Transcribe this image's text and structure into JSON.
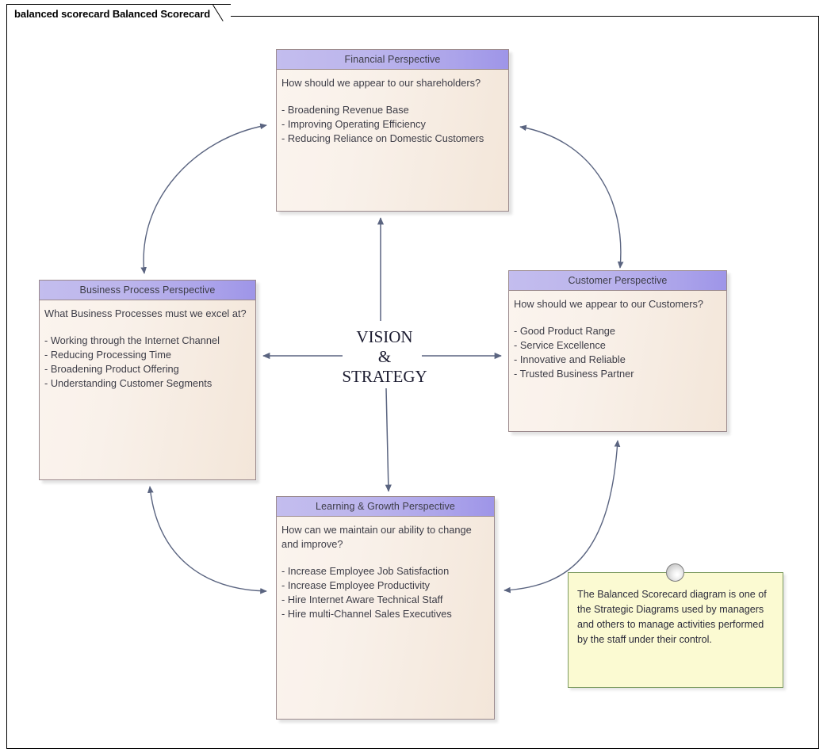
{
  "window": {
    "tab_title": "balanced scorecard Balanced Scorecard"
  },
  "center": {
    "line1": "VISION",
    "line2": "&",
    "line3": "STRATEGY"
  },
  "colors": {
    "header_light": "#c3bdee",
    "header_dark": "#9e95e8",
    "box_fill": "#f9f1ea",
    "box_border": "#9b8a8d",
    "connector": "#5a6480",
    "note_fill": "#fbfad2",
    "note_border": "#7c9a60",
    "text": "#3d3d47"
  },
  "perspectives": {
    "financial": {
      "title": "Financial Perspective",
      "question": "How should we appear to our shareholders?",
      "items": [
        "- Broadening Revenue Base",
        "- Improving Operating Efficiency",
        "- Reducing Reliance on Domestic Customers"
      ]
    },
    "business_process": {
      "title": "Business Process Perspective",
      "question": "What Business Processes must we excel at?",
      "items": [
        "- Working through the Internet Channel",
        "- Reducing Processing Time",
        "- Broadening Product Offering",
        "- Understanding Customer Segments"
      ]
    },
    "customer": {
      "title": "Customer Perspective",
      "question": "How should we appear to our Customers?",
      "items": [
        "- Good Product Range",
        "- Service Excellence",
        "- Innovative and Reliable",
        "- Trusted Business Partner"
      ]
    },
    "learning_growth": {
      "title": "Learning & Growth Perspective",
      "question": "How can we maintain our ability to change and improve?",
      "items": [
        "- Increase Employee Job Satisfaction",
        "- Increase Employee Productivity",
        "- Hire Internet Aware Technical Staff",
        "- Hire multi-Channel Sales Executives"
      ]
    }
  },
  "note": {
    "text": "The Balanced Scorecard diagram is one of the Strategic Diagrams used by managers and others to manage activities performed by the staff under their control."
  }
}
